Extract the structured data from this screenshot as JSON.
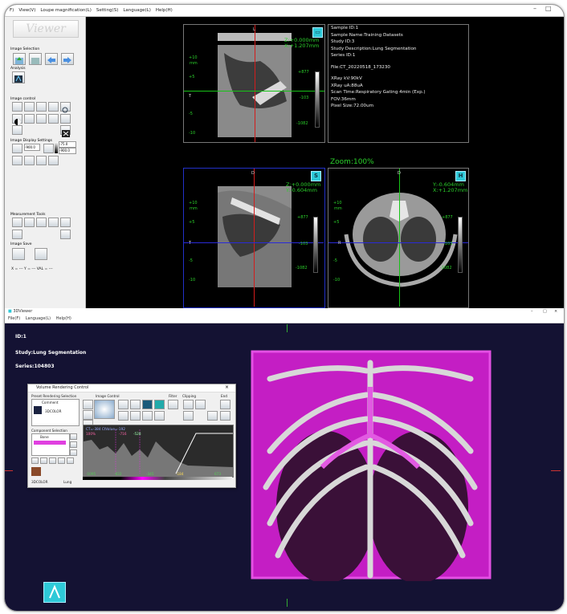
{
  "top_window": {
    "menu": [
      "F)",
      "View(V)",
      "Loupe magnification(L)",
      "Setting(S)",
      "Language(L)",
      "Help(H)"
    ],
    "window_controls": {
      "minimize": "–",
      "maximize": "□",
      "close": "×"
    },
    "logo_text": "Viewer",
    "sections": {
      "image_selection": "Image Selection",
      "analysis": "Analysis",
      "image_control": "Image control",
      "display_settings": "Image Display Settings",
      "measurement": "Measurement Tools",
      "image_save": "Image Save"
    },
    "display_values": {
      "window_low": "-900.0",
      "wl_a": "-75.0",
      "wl_b": "-900.0"
    },
    "coord_readout": "X = ---     Y = ---     VAL = ---",
    "views": {
      "sagittal": {
        "letter": "L",
        "coord1": "Z:+0.000mm",
        "coord2": "X:+1.207mm",
        "orient_left": "T",
        "ticks": [
          "+10",
          "mm",
          "+5",
          "-5",
          "-10"
        ],
        "scale_top": "+877",
        "scale_mid": "-103",
        "scale_bot": "-1082"
      },
      "coronal": {
        "letter": "D",
        "coord1": "Z:+0.000mm",
        "coord2": "Y:-0.604mm",
        "orient_left": "T",
        "ticks": [
          "+10",
          "mm",
          "+5",
          "-5",
          "-10"
        ],
        "scale_top": "+877",
        "scale_mid": "-103",
        "scale_bot": "-1082",
        "badge": "S"
      },
      "axial": {
        "letter": "D",
        "coord1": "Y:-0.604mm",
        "coord2": "X:+1.207mm",
        "orient_left": "R",
        "ticks": [
          "+10",
          "mm",
          "+5",
          "-5",
          "-10"
        ],
        "scale_top": "+877",
        "scale_mid": "-103",
        "scale_bot": "-1082",
        "badge": "H"
      }
    },
    "info": [
      "Sample ID:1",
      "Sample Name:Training Datasets",
      "Study ID:3",
      "Study Description:Lung Segmentation",
      "Series ID:1",
      "",
      "File:CT_20220518_173230",
      "",
      "XRay kV:90kV",
      "XRay uA:88uA",
      "Scan Time:Respiratory Gating 4min (Exp.)",
      "FOV:36mm",
      "Pixel Size:72.00um"
    ],
    "zoom": "Zoom:100%"
  },
  "bottom_window": {
    "title": "3DViewer",
    "window_controls": {
      "minimize": "–",
      "maximize": "□",
      "close": "×"
    },
    "menu": [
      "File(F)",
      "Language(L)",
      "Help(H)"
    ],
    "overlay": {
      "id": "ID:1",
      "study": "Study:Lung Segmentation",
      "series": "Series:104803"
    },
    "vrc": {
      "title": "Volume Rendering Control",
      "preset_label": "Preset Rendering Selection",
      "preset_comment": "Comment",
      "preset_item": "3DCOLOR",
      "image_control": "Image Control",
      "filter": "Filter",
      "clipping": "Clipping",
      "end": "End",
      "component_label": "Component Selection",
      "component_name": "Bone",
      "ct_info": "CT=-384 CtValue=-192",
      "percent": "100%",
      "peaks": [
        "-716",
        "-528"
      ],
      "axis_labels": [
        "-1095",
        "-832",
        "-345",
        "-184",
        "673"
      ],
      "footer_left": "3DCOLOR",
      "footer_right": "Lung"
    }
  },
  "colors": {
    "green_text": "#2bd12b",
    "crosshair_green": "#17c317",
    "crosshair_blue": "#2a2ad9",
    "crosshair_red": "#d21d1d",
    "badge_cyan": "#2ec9d8",
    "lung_magenta": "#d61fd6",
    "viewer_bg": "#141233"
  }
}
